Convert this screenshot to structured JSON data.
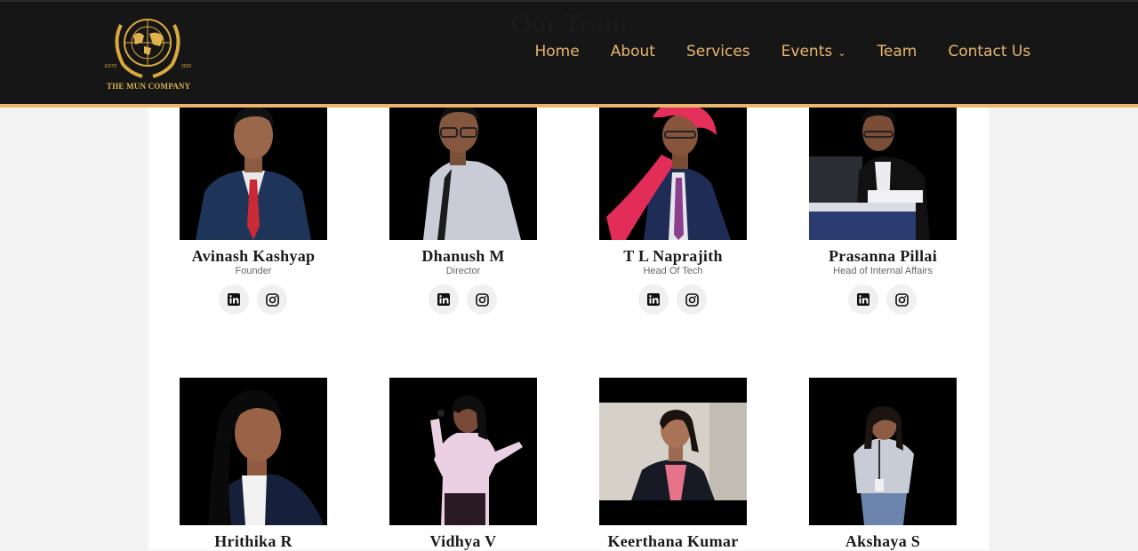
{
  "brand": {
    "logo_text": "THE MUN COMPANY",
    "logo_estd": "ESTD",
    "logo_year": "2020"
  },
  "page": {
    "title": "Our Team"
  },
  "nav": {
    "items": [
      {
        "label": "Home"
      },
      {
        "label": "About"
      },
      {
        "label": "Services"
      },
      {
        "label": "Events",
        "has_dropdown": true
      },
      {
        "label": "Team"
      },
      {
        "label": "Contact Us"
      }
    ]
  },
  "colors": {
    "accent": "#e9b66c",
    "header_bg": "#161616"
  },
  "team": [
    {
      "name": "Avinash Kashyap",
      "role": "Founder",
      "socials": [
        "linkedin-icon",
        "instagram-icon"
      ]
    },
    {
      "name": "Dhanush M",
      "role": "Director",
      "socials": [
        "linkedin-icon",
        "instagram-icon"
      ]
    },
    {
      "name": "T L Naprajith",
      "role": "Head Of Tech",
      "socials": [
        "linkedin-icon",
        "instagram-icon"
      ]
    },
    {
      "name": "Prasanna Pillai",
      "role": "Head of Internal Affairs",
      "socials": [
        "linkedin-icon",
        "instagram-icon"
      ]
    },
    {
      "name": "Hrithika R",
      "role": ""
    },
    {
      "name": "Vidhya V",
      "role": ""
    },
    {
      "name": "Keerthana Kumar",
      "role": ""
    },
    {
      "name": "Akshaya S",
      "role": ""
    }
  ]
}
